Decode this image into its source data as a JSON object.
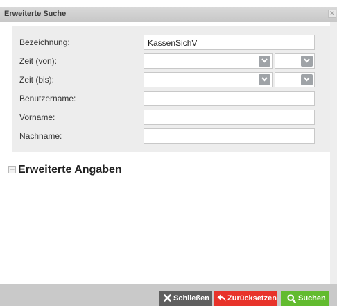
{
  "dialog": {
    "title": "Erweiterte Suche",
    "close_glyph": "×"
  },
  "form": {
    "fields": [
      {
        "label": "Bezeichnung:",
        "value": "KassenSichV",
        "type": "text"
      },
      {
        "label": "Zeit (von):",
        "value": "",
        "type": "select-pair"
      },
      {
        "label": "Zeit (bis):",
        "value": "",
        "type": "select-pair"
      },
      {
        "label": "Benutzername:",
        "value": "",
        "type": "text"
      },
      {
        "label": "Vorname:",
        "value": "",
        "type": "text"
      },
      {
        "label": "Nachname:",
        "value": "",
        "type": "text"
      }
    ]
  },
  "expander": {
    "icon": "plus-icon",
    "glyph": "+",
    "label": "Erweiterte Angaben"
  },
  "footer": {
    "close_label": "Schließen",
    "reset_label": "Zurücksetzen",
    "search_label": "Suchen"
  },
  "colors": {
    "close_button": "#5f5f5f",
    "reset_button": "#e8332a",
    "search_button": "#62bb2f",
    "panel_bg": "#ededed"
  }
}
